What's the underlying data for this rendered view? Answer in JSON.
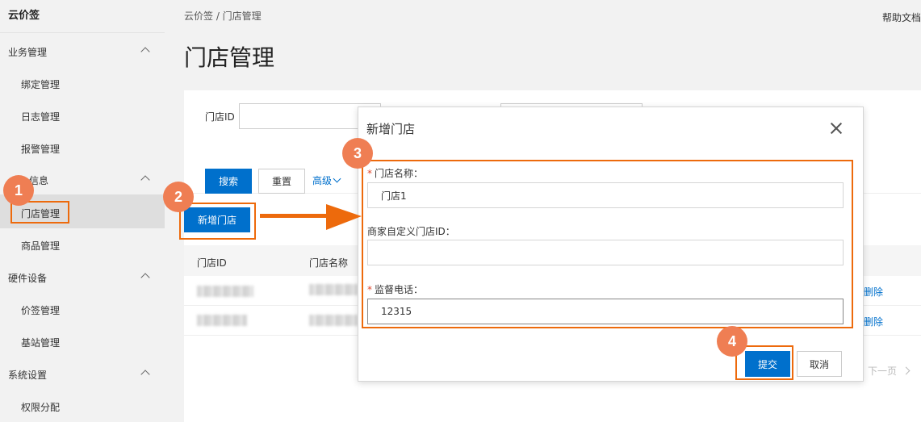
{
  "sidebar": {
    "brand": "云价签",
    "groups": [
      {
        "label": "业务管理"
      },
      {
        "label": "信息"
      },
      {
        "label": "硬件设备"
      },
      {
        "label": "系统设置"
      }
    ],
    "items": [
      {
        "label": "绑定管理"
      },
      {
        "label": "日志管理"
      },
      {
        "label": "报警管理"
      },
      {
        "label": "门店管理"
      },
      {
        "label": "商品管理"
      },
      {
        "label": "价签管理"
      },
      {
        "label": "基站管理"
      },
      {
        "label": "权限分配"
      }
    ]
  },
  "header": {
    "breadcrumb": "云价签  /  门店管理",
    "help": "帮助文档",
    "page_title": "门店管理"
  },
  "filter": {
    "store_id_label": "门店ID",
    "search_label": "搜索",
    "reset_label": "重置",
    "advanced_label": "高级"
  },
  "toolbar": {
    "add_store_label": "新增门店"
  },
  "table": {
    "columns": [
      "门店ID",
      "门店名称"
    ],
    "row_action": "删除"
  },
  "pager": {
    "next_label": "下一页"
  },
  "dialog": {
    "title": "新增门店",
    "fields": [
      {
        "label": "门店名称：",
        "required": true,
        "value": "门店1"
      },
      {
        "label": "商家自定义门店ID：",
        "required": false,
        "value": ""
      },
      {
        "label": "监督电话：",
        "required": true,
        "value": "12315"
      }
    ],
    "submit_label": "提交",
    "cancel_label": "取消"
  },
  "annotations": {
    "steps": [
      "1",
      "2",
      "3",
      "4"
    ],
    "highlight_color": "#ed6a0c",
    "badge_color": "#ef7e53"
  },
  "colors": {
    "primary": "#0070cc",
    "required": "#e0462b"
  }
}
